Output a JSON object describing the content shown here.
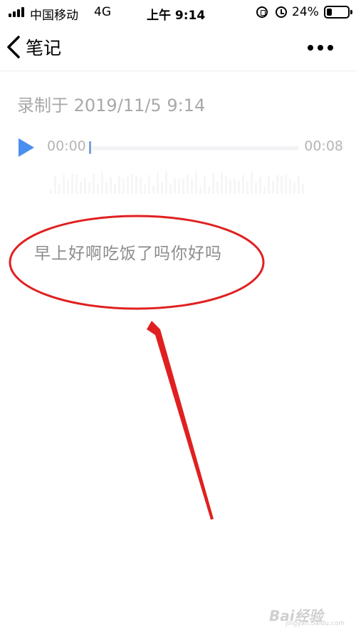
{
  "status_bar": {
    "carrier": "中国移动",
    "network": "4G",
    "time": "上午 9:14",
    "battery_percent": "24%",
    "battery_level": 0.24
  },
  "nav": {
    "title": "笔记"
  },
  "recording": {
    "title": "录制于 2019/11/5 9:14",
    "current_time": "00:00",
    "duration": "00:08",
    "progress": 0.0
  },
  "note": {
    "content": "早上好啊吃饭了吗你好吗"
  },
  "watermark": {
    "text": "Bai经验",
    "sub": "jingyan.baidu.com"
  },
  "colors": {
    "accent": "#4a8ef0",
    "annotation": "#e02020",
    "muted_text": "#a8a8a8"
  }
}
